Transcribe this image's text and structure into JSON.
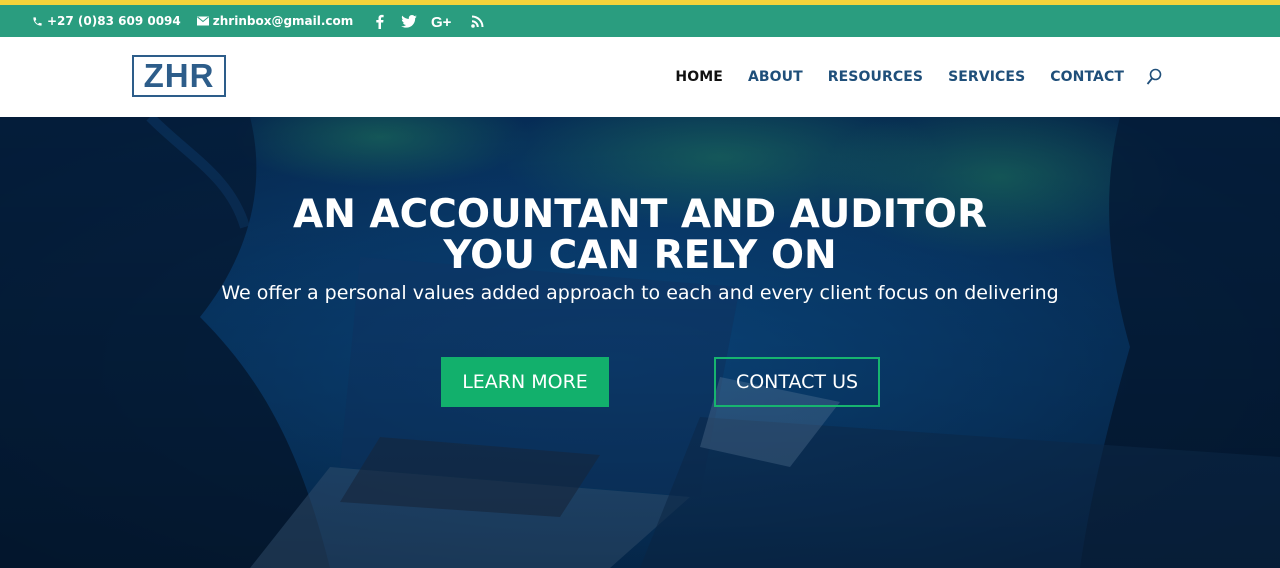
{
  "topbar": {
    "phone": "+27 (0)83 609 0094",
    "email": "zhrinbox@gmail.com",
    "social": [
      "facebook-icon",
      "twitter-icon",
      "google-plus-icon",
      "rss-icon"
    ],
    "colors": {
      "background": "#2a9d7f",
      "accent_stripe": "#f5d33a"
    }
  },
  "header": {
    "logo_text": "ZHR",
    "nav": {
      "home": "HOME",
      "about": "ABOUT",
      "resources": "RESOURCES",
      "services": "SERVICES",
      "contact": "CONTACT"
    },
    "search_icon": "search-icon"
  },
  "hero": {
    "title_line1": "AN ACCOUNTANT AND AUDITOR",
    "title_line2": "YOU CAN RELY ON",
    "subtitle": "We offer a personal values added approach to each and every client focus on delivering",
    "learn_more": "LEARN MORE",
    "contact_us": "CONTACT US",
    "colors": {
      "overlay": "#0b4b86",
      "button": "#12b06c"
    }
  }
}
